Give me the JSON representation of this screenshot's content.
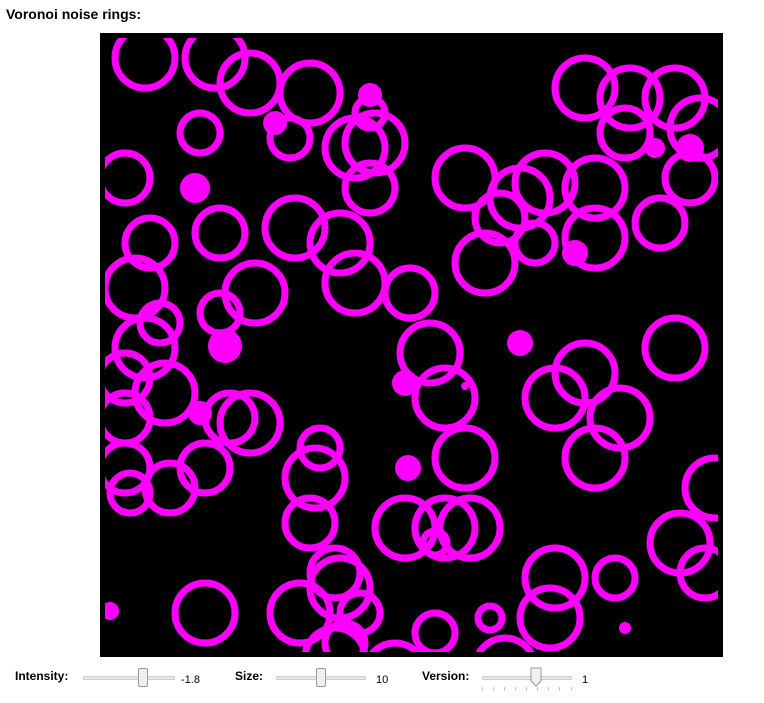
{
  "title": "Voronoi noise rings:",
  "colors": {
    "ring": "#ff00ff",
    "canvas": "#000000"
  },
  "controls": {
    "intensity": {
      "label": "Intensity:",
      "value": "-1.8"
    },
    "size": {
      "label": "Size:",
      "value": "10"
    },
    "version": {
      "label": "Version:",
      "value": "1"
    }
  }
}
